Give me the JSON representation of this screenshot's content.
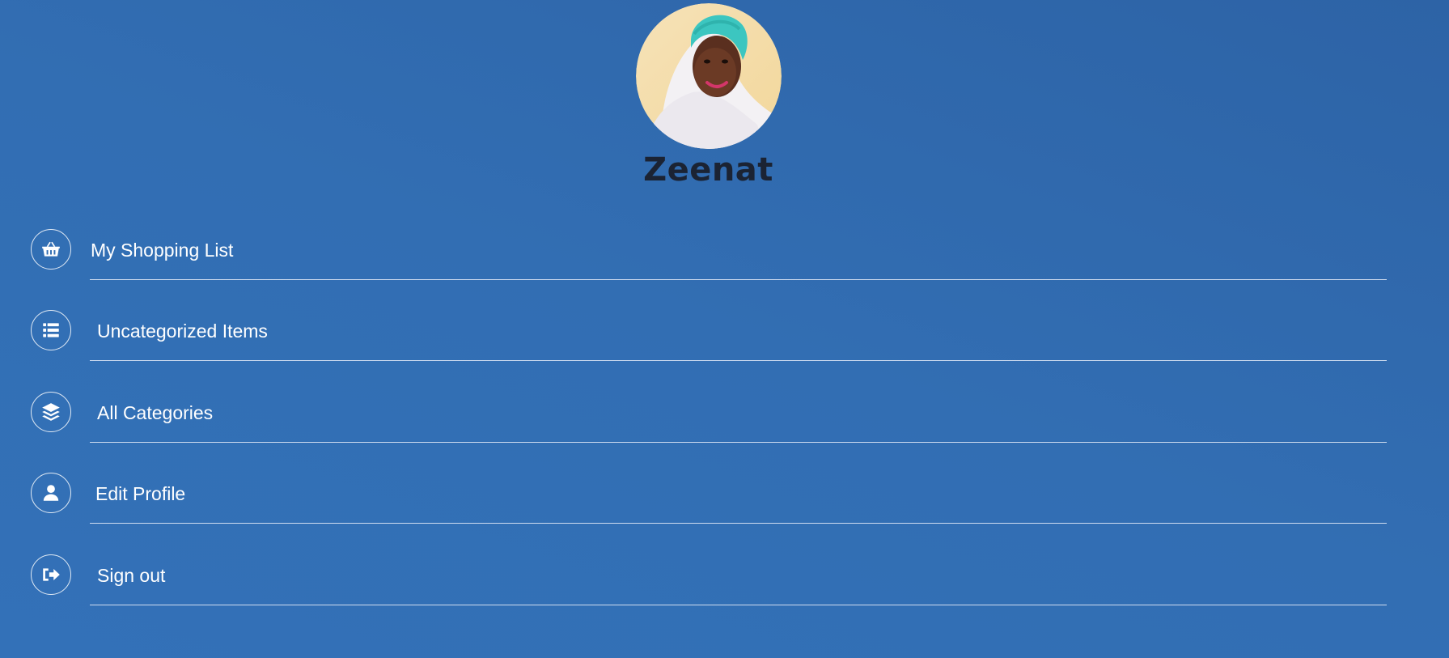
{
  "profile": {
    "name": "Zeenat"
  },
  "menu": {
    "items": [
      {
        "label": "My Shopping List",
        "icon": "basket-icon"
      },
      {
        "label": "Uncategorized Items",
        "icon": "list-icon"
      },
      {
        "label": "All Categories",
        "icon": "layers-icon"
      },
      {
        "label": "Edit Profile",
        "icon": "user-icon"
      },
      {
        "label": "Sign out",
        "icon": "sign-out-icon"
      }
    ]
  },
  "colors": {
    "background": "#326eb3",
    "name_text": "#1b2333",
    "menu_text": "#ffffff",
    "divider": "#ebf0fa"
  }
}
